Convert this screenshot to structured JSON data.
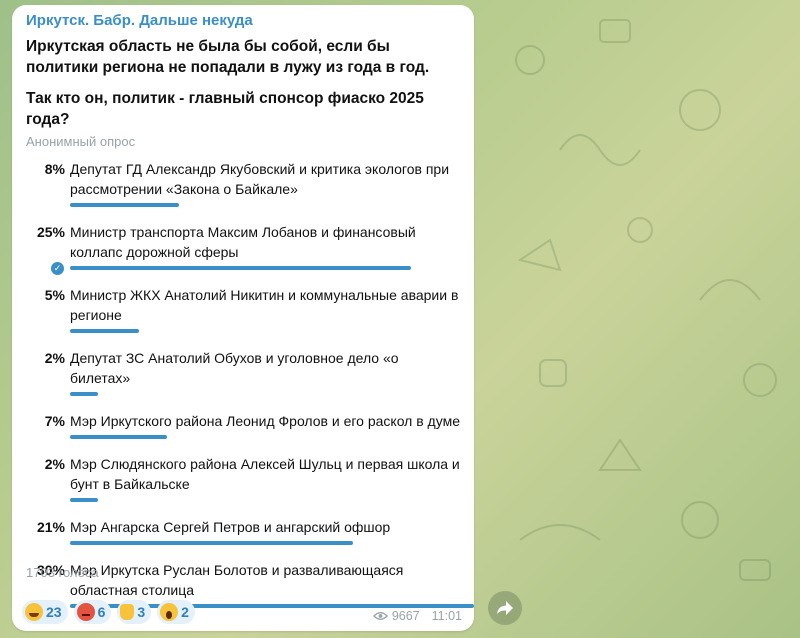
{
  "channel_title": "Иркутск. Бабр. Дальше некуда",
  "question_lines": [
    "Иркутская область не была бы собой, если бы политики региона не попадали в лужу из года в год.",
    "Так кто он, политик - главный спонсор фиаско 2025 года?"
  ],
  "poll_type": "Анонимный опрос",
  "options": [
    {
      "percent": "8%",
      "label": "Депутат ГД Александр Якубовский и критика экологов при рассмотрении «Закона о Байкале»",
      "share": 0.27,
      "chosen": false
    },
    {
      "percent": "25%",
      "label": "Министр транспорта Максим Лобанов и финансовый коллапс дорожной сферы",
      "share": 0.845,
      "chosen": true
    },
    {
      "percent": "5%",
      "label": "Министр ЖКХ Анатолий Никитин и коммунальные аварии в регионе",
      "share": 0.17,
      "chosen": false
    },
    {
      "percent": "2%",
      "label": "Депутат ЗС Анатолий Обухов и уголовное дело «о билетах»",
      "share": 0.07,
      "chosen": false
    },
    {
      "percent": "7%",
      "label": "Мэр Иркутского района Леонид Фролов и его раскол в думе",
      "share": 0.24,
      "chosen": false
    },
    {
      "percent": "2%",
      "label": "Мэр Слюдянского района Алексей Шульц и первая школа и бунт в Байкальске",
      "share": 0.07,
      "chosen": false
    },
    {
      "percent": "21%",
      "label": "Мэр Ангарска Сергей Петров и ангарский офшор",
      "share": 0.7,
      "chosen": false
    },
    {
      "percent": "30%",
      "label": "Мэр Иркутска Руслан Болотов и разваливающаяся областная столица",
      "share": 1.0,
      "chosen": false
    }
  ],
  "total_votes": "1703 голоса",
  "reactions": [
    {
      "emoji": "laugh",
      "count": "23"
    },
    {
      "emoji": "angry",
      "count": "6"
    },
    {
      "emoji": "thumbs-up",
      "count": "3"
    },
    {
      "emoji": "scream",
      "count": "2"
    }
  ],
  "views": "9667",
  "time": "11:01",
  "colors": {
    "accent": "#3a8fc7",
    "muted": "#98a2a8",
    "reaction_bg": "#e4f0fa"
  }
}
